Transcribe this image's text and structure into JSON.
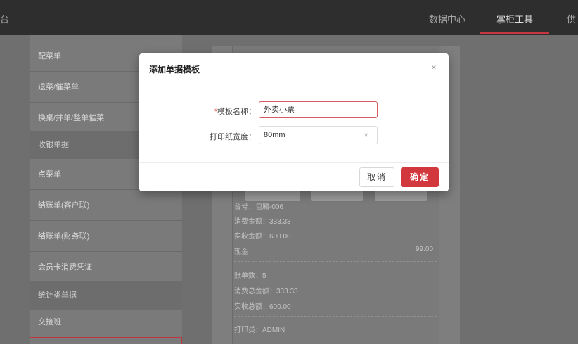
{
  "topbar": {
    "left_fragment": "台",
    "nav": [
      "数据中心",
      "掌柜工具",
      "供"
    ],
    "active_index": 1
  },
  "sidebar": {
    "items": [
      {
        "label": "配菜单",
        "group": false
      },
      {
        "label": "退菜/催菜单",
        "group": false
      },
      {
        "label": "换桌/并单/整单催菜",
        "group": false
      },
      {
        "label": "收银单据",
        "group": true
      },
      {
        "label": "点菜单",
        "group": false
      },
      {
        "label": "结账单(客户联)",
        "group": false
      },
      {
        "label": "结账单(财务联)",
        "group": false
      },
      {
        "label": "会员卡消费凭证",
        "group": false
      },
      {
        "label": "统计类单据",
        "group": true
      },
      {
        "label": "交接班",
        "group": false
      }
    ]
  },
  "receipt": {
    "table": "台号：包厢-006",
    "consume_amount": "消费金额：333.33",
    "received_amount": "实收金额：600.00",
    "cash_label": "现金",
    "cash_value": "99.00",
    "bill_count": "账单数：5",
    "total_consume": "消费总金额：333.33",
    "total_received": "实收总额：600.00",
    "printer": "打印员：ADMIN"
  },
  "modal": {
    "title": "添加单据模板",
    "close_glyph": "×",
    "name_required_mark": "*",
    "name_label": "模板名称：",
    "name_value": "外卖小票",
    "width_label": "打印纸宽度：",
    "width_value": "80mm",
    "chevron_glyph": "∨",
    "cancel_label": "取消",
    "ok_label": "确定"
  },
  "colors": {
    "accent": "#d2373e",
    "topbar_bg": "#2e2e2e"
  }
}
